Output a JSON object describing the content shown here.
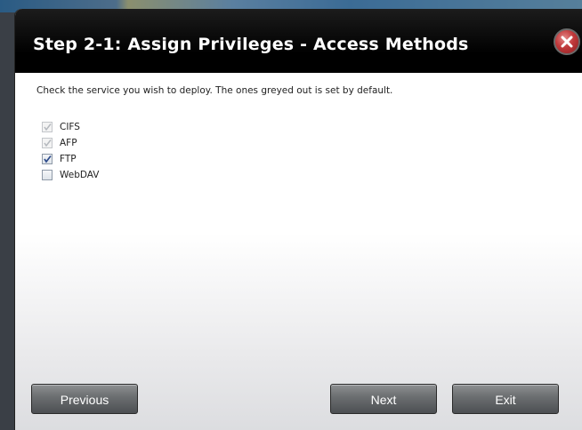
{
  "dialog": {
    "title": "Step 2-1: Assign Privileges - Access Methods",
    "close_icon": "close-icon",
    "instruction": "Check the service you wish to deploy. The ones greyed out is set by default.",
    "options": [
      {
        "label": "CIFS",
        "checked": true,
        "disabled": true
      },
      {
        "label": "AFP",
        "checked": true,
        "disabled": true
      },
      {
        "label": "FTP",
        "checked": true,
        "disabled": false
      },
      {
        "label": "WebDAV",
        "checked": false,
        "disabled": false
      }
    ],
    "buttons": {
      "previous": "Previous",
      "next": "Next",
      "exit": "Exit"
    }
  },
  "colors": {
    "titlebar": "#000000",
    "close": "#c0393b",
    "button": "#6d7072"
  }
}
